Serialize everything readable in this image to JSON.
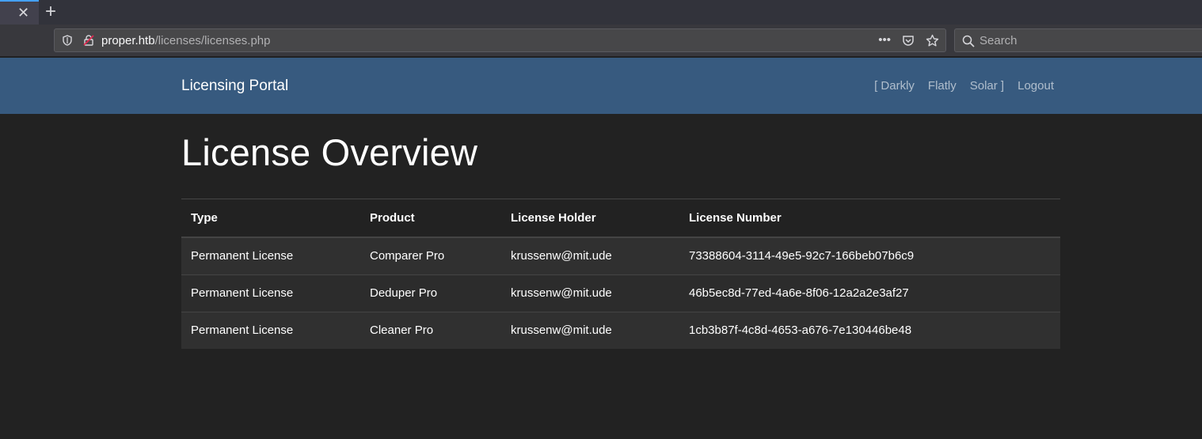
{
  "browser": {
    "tab_close": "✕",
    "new_tab": "+",
    "url_host": "proper.htb",
    "url_path": "/licenses/licenses.php",
    "url_menu": "•••",
    "search_placeholder": "Search"
  },
  "site": {
    "brand": "Licensing Portal",
    "themes": [
      "[ Darkly",
      "Flatly",
      "Solar ]"
    ],
    "logout": "Logout",
    "accent": "#375a7f"
  },
  "main": {
    "title": "License Overview",
    "table": {
      "columns": [
        "Type",
        "Product",
        "License Holder",
        "License Number"
      ],
      "rows": [
        [
          "Permanent License",
          "Comparer Pro",
          "krussenw@mit.ude",
          "73388604-3114-49e5-92c7-166beb07b6c9"
        ],
        [
          "Permanent License",
          "Deduper Pro",
          "krussenw@mit.ude",
          "46b5ec8d-77ed-4a6e-8f06-12a2a2e3af27"
        ],
        [
          "Permanent License",
          "Cleaner Pro",
          "krussenw@mit.ude",
          "1cb3b87f-4c8d-4653-a676-7e130446be48"
        ]
      ]
    }
  }
}
